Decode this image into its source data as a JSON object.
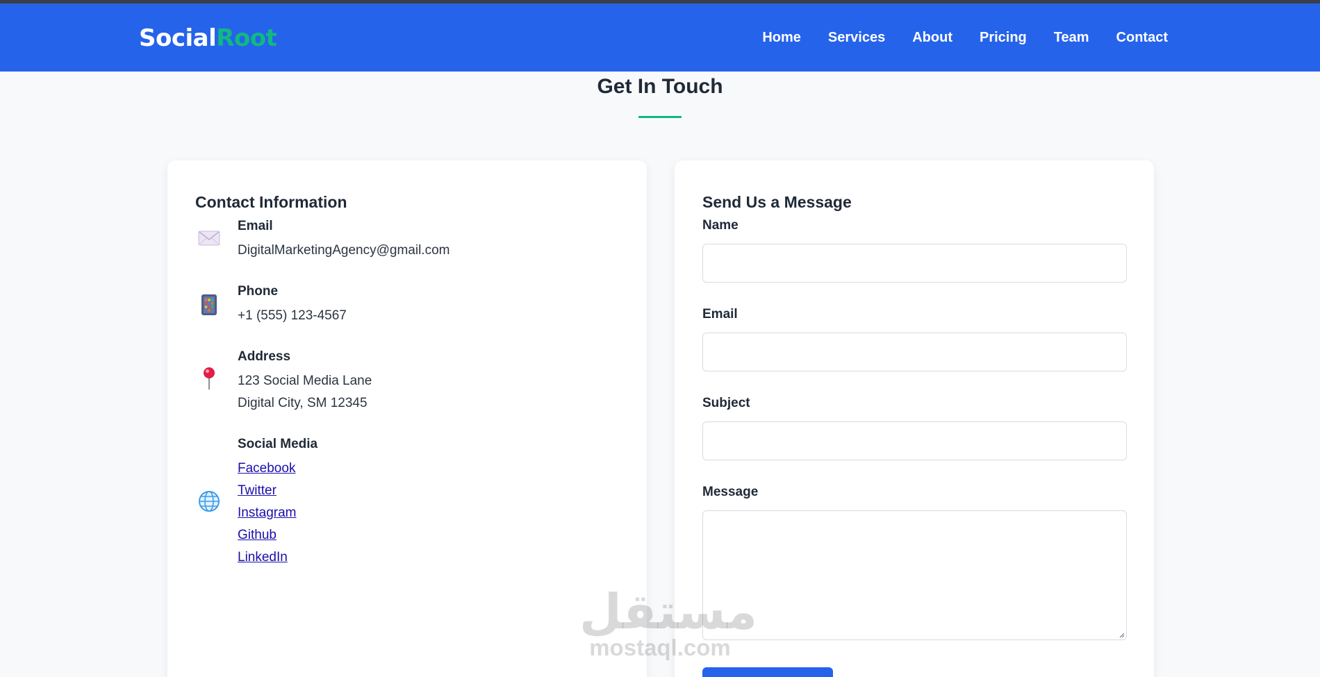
{
  "nav": {
    "brand_part1": "Social",
    "brand_part2": "Root",
    "links": [
      "Home",
      "Services",
      "About",
      "Pricing",
      "Team",
      "Contact"
    ]
  },
  "section": {
    "title": "Get In Touch"
  },
  "contact_info": {
    "heading": "Contact Information",
    "email": {
      "label": "Email",
      "value": "DigitalMarketingAgency@gmail.com",
      "icon": "envelope-icon"
    },
    "phone": {
      "label": "Phone",
      "value": "+1 (555) 123-4567",
      "icon": "phone-icon"
    },
    "address": {
      "label": "Address",
      "line1": "123 Social Media Lane",
      "line2": "Digital City, SM 12345",
      "icon": "pushpin-icon"
    },
    "social": {
      "label": "Social Media",
      "icon": "globe-icon",
      "links": [
        "Facebook",
        "Twitter",
        "Instagram",
        "Github",
        "LinkedIn"
      ]
    }
  },
  "form": {
    "heading": "Send Us a Message",
    "name_label": "Name",
    "email_label": "Email",
    "subject_label": "Subject",
    "message_label": "Message"
  },
  "watermark": {
    "arabic": "مستقل",
    "latin": "mostaql.com"
  },
  "colors": {
    "nav_bg": "#2563eb",
    "accent_green": "#10b981",
    "link": "#1a0dab"
  }
}
